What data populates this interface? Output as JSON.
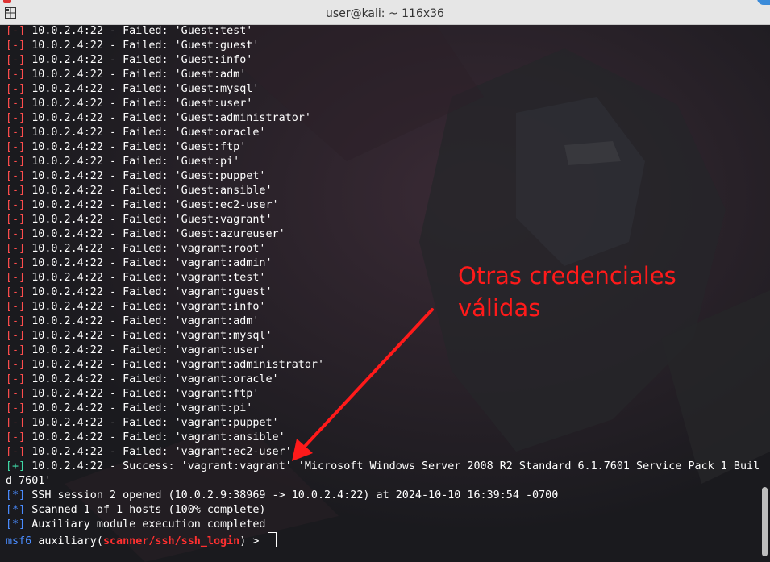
{
  "window": {
    "title": "user@kali: ~ 116x36"
  },
  "colors": {
    "fail": "#ff4d4d",
    "success": "#3fd8a6",
    "info": "#4a8cff",
    "annotation": "#ff1a1a"
  },
  "icons": {
    "menu": "terminal-menu-icon"
  },
  "terminal": {
    "failed_lines": [
      "10.0.2.4:22 - Failed: 'Guest:test'",
      "10.0.2.4:22 - Failed: 'Guest:guest'",
      "10.0.2.4:22 - Failed: 'Guest:info'",
      "10.0.2.4:22 - Failed: 'Guest:adm'",
      "10.0.2.4:22 - Failed: 'Guest:mysql'",
      "10.0.2.4:22 - Failed: 'Guest:user'",
      "10.0.2.4:22 - Failed: 'Guest:administrator'",
      "10.0.2.4:22 - Failed: 'Guest:oracle'",
      "10.0.2.4:22 - Failed: 'Guest:ftp'",
      "10.0.2.4:22 - Failed: 'Guest:pi'",
      "10.0.2.4:22 - Failed: 'Guest:puppet'",
      "10.0.2.4:22 - Failed: 'Guest:ansible'",
      "10.0.2.4:22 - Failed: 'Guest:ec2-user'",
      "10.0.2.4:22 - Failed: 'Guest:vagrant'",
      "10.0.2.4:22 - Failed: 'Guest:azureuser'",
      "10.0.2.4:22 - Failed: 'vagrant:root'",
      "10.0.2.4:22 - Failed: 'vagrant:admin'",
      "10.0.2.4:22 - Failed: 'vagrant:test'",
      "10.0.2.4:22 - Failed: 'vagrant:guest'",
      "10.0.2.4:22 - Failed: 'vagrant:info'",
      "10.0.2.4:22 - Failed: 'vagrant:adm'",
      "10.0.2.4:22 - Failed: 'vagrant:mysql'",
      "10.0.2.4:22 - Failed: 'vagrant:user'",
      "10.0.2.4:22 - Failed: 'vagrant:administrator'",
      "10.0.2.4:22 - Failed: 'vagrant:oracle'",
      "10.0.2.4:22 - Failed: 'vagrant:ftp'",
      "10.0.2.4:22 - Failed: 'vagrant:pi'",
      "10.0.2.4:22 - Failed: 'vagrant:puppet'",
      "10.0.2.4:22 - Failed: 'vagrant:ansible'",
      "10.0.2.4:22 - Failed: 'vagrant:ec2-user'"
    ],
    "fail_marker": "[-]",
    "success_marker": "[+]",
    "info_marker": "[*]",
    "success_line_1": "10.0.2.4:22 - Success: 'vagrant:vagrant' 'Microsoft Windows Server 2008 R2 Standard 6.1.7601 Service Pack 1 Buil",
    "success_line_2": "d 7601'",
    "info_lines": [
      "SSH session 2 opened (10.0.2.9:38969 -> 10.0.2.4:22) at 2024-10-10 16:39:54 -0700",
      "Scanned 1 of 1 hosts (100% complete)",
      "Auxiliary module execution completed"
    ],
    "prompt": {
      "name": "msf6",
      "module_prefix": "auxiliary(",
      "module": "scanner/ssh/ssh_login",
      "module_suffix": ") > "
    }
  },
  "annotation": {
    "text": "Otras credenciales\nválidas"
  }
}
